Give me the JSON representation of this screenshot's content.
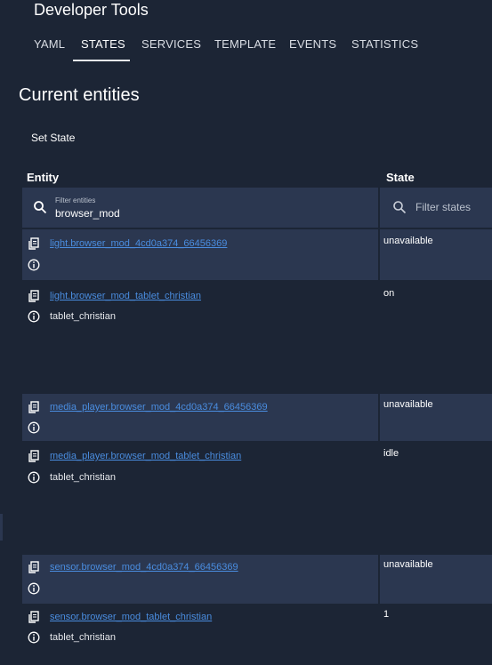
{
  "header": {
    "title": "Developer Tools"
  },
  "tabs": [
    {
      "label": "YAML"
    },
    {
      "label": "STATES"
    },
    {
      "label": "SERVICES"
    },
    {
      "label": "TEMPLATE"
    },
    {
      "label": "EVENTS"
    },
    {
      "label": "STATISTICS"
    }
  ],
  "active_tab": "STATES",
  "page": {
    "title": "Current entities",
    "set_state": "Set State"
  },
  "table": {
    "entity_header": "Entity",
    "state_header": "State",
    "filter_entities_label": "Filter entities",
    "filter_entities_value": "browser_mod",
    "filter_states_placeholder": "Filter states"
  },
  "rows": [
    {
      "entity": "light.browser_mod_4cd0a374_66456369",
      "state": "unavailable",
      "attr": ""
    },
    {
      "entity": "light.browser_mod_tablet_christian",
      "state": "on",
      "attr": "tablet_christian"
    },
    {
      "entity": "media_player.browser_mod_4cd0a374_66456369",
      "state": "unavailable",
      "attr": ""
    },
    {
      "entity": "media_player.browser_mod_tablet_christian",
      "state": "idle",
      "attr": "tablet_christian"
    },
    {
      "entity": "sensor.browser_mod_4cd0a374_66456369",
      "state": "unavailable",
      "attr": ""
    },
    {
      "entity": "sensor.browser_mod_tablet_christian",
      "state": "1",
      "attr": "tablet_christian"
    }
  ],
  "colors": {
    "background": "#1c2535",
    "row_alt": "#2b3750",
    "link": "#4a8de0"
  },
  "icons": [
    "search-icon",
    "clipboard-icon",
    "info-icon"
  ]
}
